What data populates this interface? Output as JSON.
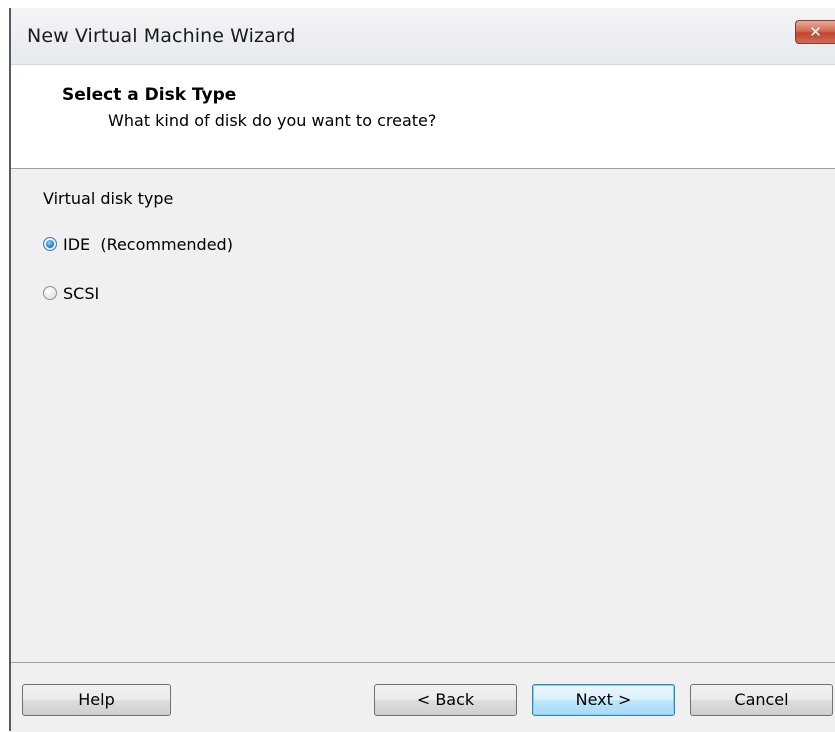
{
  "window": {
    "title": "New Virtual Machine Wizard",
    "close_glyph": "✕"
  },
  "header": {
    "title": "Select a Disk Type",
    "subtitle": "What kind of disk do you want to create?"
  },
  "content": {
    "group_label": "Virtual disk type",
    "options": [
      {
        "label": "IDE  (Recommended)",
        "checked": true
      },
      {
        "label": "SCSI",
        "checked": false
      }
    ]
  },
  "footer": {
    "help_label": "Help",
    "back_label": "< Back",
    "next_label": "Next >",
    "cancel_label": "Cancel"
  },
  "colors": {
    "accent": "#3c7fb1",
    "close_button": "#c0432b",
    "panel_bg": "#f0f0f0"
  }
}
